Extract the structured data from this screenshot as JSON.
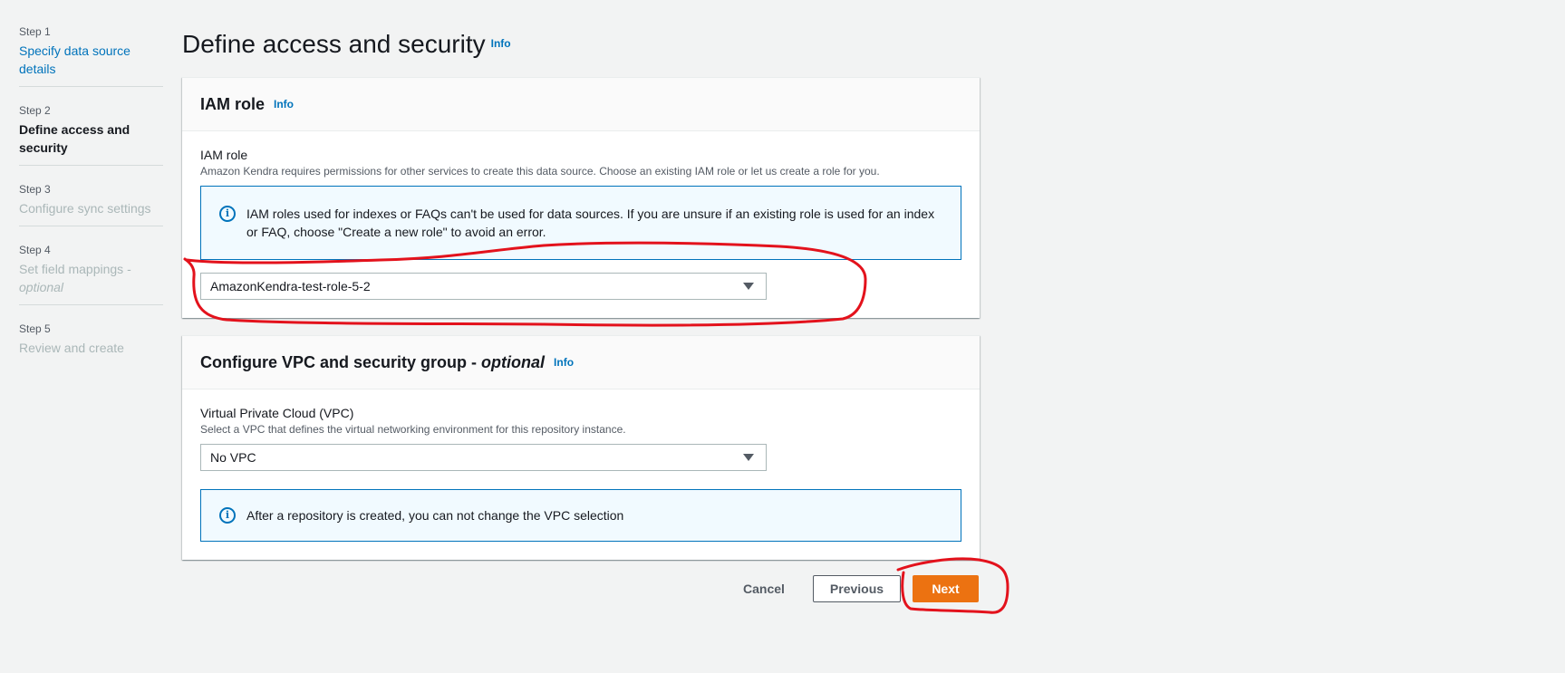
{
  "steps": [
    {
      "num": "Step 1",
      "label": "Specify data source details",
      "state": "link"
    },
    {
      "num": "Step 2",
      "label": "Define access and security",
      "state": "active"
    },
    {
      "num": "Step 3",
      "label": "Configure sync settings",
      "state": "disabled"
    },
    {
      "num": "Step 4",
      "label": "Set field mappings - ",
      "label_italic": "optional",
      "state": "disabled"
    },
    {
      "num": "Step 5",
      "label": "Review and create",
      "state": "disabled"
    }
  ],
  "page": {
    "title": "Define access and security",
    "info": "Info"
  },
  "iam_panel": {
    "heading": "IAM role",
    "info": "Info",
    "field_label": "IAM role",
    "field_desc": "Amazon Kendra requires permissions for other services to create this data source. Choose an existing IAM role or let us create a role for you.",
    "alert_icon": "info-icon",
    "alert_text": "IAM roles used for indexes or FAQs can't be used for data sources. If you are unsure if an existing role is used for an index or FAQ, choose \"Create a new role\" to avoid an error.",
    "selected_role": "AmazonKendra-test-role-5-2"
  },
  "vpc_panel": {
    "heading": "Configure VPC and security group - ",
    "heading_italic": "optional",
    "info": "Info",
    "field_label": "Virtual Private Cloud (VPC)",
    "field_desc": "Select a VPC that defines the virtual networking environment for this repository instance.",
    "selected_vpc": "No VPC",
    "alert_icon": "info-icon",
    "alert_text": "After a repository is created, you can not change the VPC selection"
  },
  "actions": {
    "cancel": "Cancel",
    "previous": "Previous",
    "next": "Next"
  },
  "colors": {
    "primary_button": "#ec7211",
    "link": "#0073bb",
    "annotation": "#e3121c"
  }
}
